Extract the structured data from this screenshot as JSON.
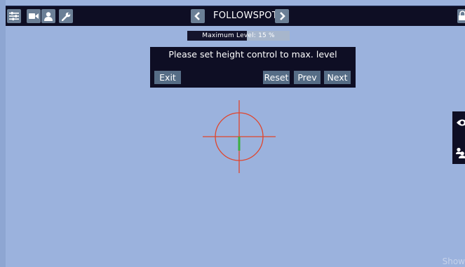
{
  "toolbar": {
    "icons": [
      "sliders-icon",
      "video-camera-icon",
      "person-icon",
      "wrench-icon"
    ],
    "title": "FOLLOWSPOT",
    "prev_arrow": "chevron-left-icon",
    "next_arrow": "chevron-right-icon",
    "lock_icon": "lock-icon"
  },
  "level": {
    "label": "Maximum Level: 15 %",
    "fill_fraction": 0.58
  },
  "dialog": {
    "message": "Please set height control to max. level",
    "exit_label": "Exit",
    "reset_label": "Reset",
    "prev_label": "Prev",
    "next_label": "Next"
  },
  "side_panel": {
    "icons": [
      "eye-icon",
      "people-icon"
    ]
  },
  "footer": {
    "show_label": "Show"
  },
  "colors": {
    "background": "#9bb2dd",
    "bar": "#0e0e24",
    "button": "#566d86",
    "crosshair": "#e0452c",
    "level_indicator": "#3cae3f"
  }
}
